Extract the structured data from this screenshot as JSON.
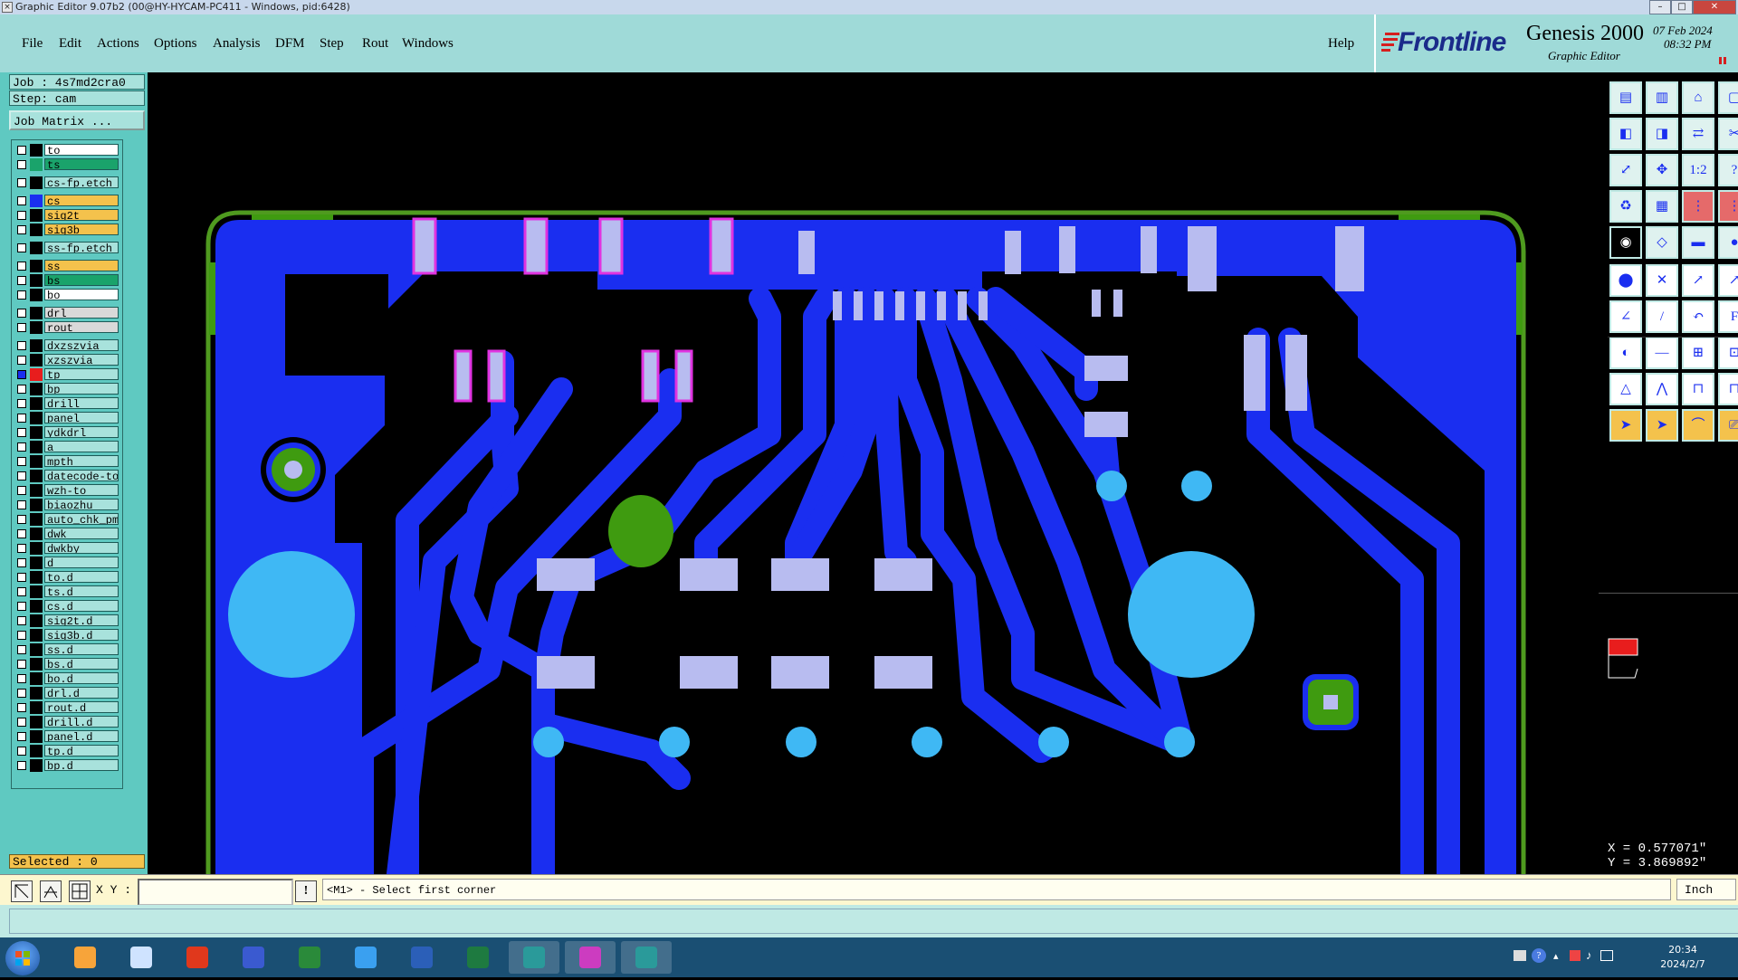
{
  "window": {
    "title": "Graphic Editor 9.07b2 (00@HY-HYCAM-PC411 - Windows, pid:6428)"
  },
  "menubar": {
    "items": [
      "File",
      "Edit",
      "Actions",
      "Options",
      "Analysis",
      "DFM",
      "Step",
      "Rout",
      "Windows"
    ],
    "help": "Help"
  },
  "brand": {
    "logo": "Frontline",
    "product": "Genesis 2000",
    "subtitle": "Graphic Editor",
    "date": "07 Feb 2024",
    "time": "08:32 PM"
  },
  "job": {
    "job_label": "Job : 4s7md2cra0",
    "step_label": "Step: cam",
    "matrix_button": "Job Matrix ..."
  },
  "layers": [
    {
      "name": "to",
      "color": "#ffffff",
      "swatch": "#000000",
      "group": 0
    },
    {
      "name": "ts",
      "color": "#1aa36b",
      "swatch": "#1aa36b",
      "group": 0
    },
    {
      "name": "cs-fp.etch",
      "color": "#a8e2dc",
      "swatch": "#000000",
      "group": 1
    },
    {
      "name": "cs",
      "color": "#f4c24c",
      "swatch": "#1a2ef0",
      "group": 2
    },
    {
      "name": "sig2t",
      "color": "#f4c24c",
      "swatch": "#000000",
      "group": 2
    },
    {
      "name": "sig3b",
      "color": "#f4c24c",
      "swatch": "#000000",
      "group": 2
    },
    {
      "name": "ss-fp.etch",
      "color": "#a8e2dc",
      "swatch": "#000000",
      "group": 3
    },
    {
      "name": "ss",
      "color": "#f4c24c",
      "swatch": "#000000",
      "group": 4
    },
    {
      "name": "bs",
      "color": "#1aa36b",
      "swatch": "#000000",
      "group": 4
    },
    {
      "name": "bo",
      "color": "#ffffff",
      "swatch": "#000000",
      "group": 4
    },
    {
      "name": "drl",
      "color": "#d9d9d9",
      "swatch": "#000000",
      "group": 5
    },
    {
      "name": "rout",
      "color": "#d9d9d9",
      "swatch": "#000000",
      "group": 5
    },
    {
      "name": "dxzszvia",
      "color": "#a8e2dc",
      "swatch": "#000000",
      "group": 6
    },
    {
      "name": "xzszvia",
      "color": "#a8e2dc",
      "swatch": "#000000",
      "group": 6
    },
    {
      "name": "tp",
      "color": "#a8e2dc",
      "swatch": "#e81d1d",
      "group": 6,
      "active": true
    },
    {
      "name": "bp",
      "color": "#a8e2dc",
      "swatch": "#000000",
      "group": 6
    },
    {
      "name": "drill",
      "color": "#a8e2dc",
      "swatch": "#000000",
      "group": 6
    },
    {
      "name": "panel",
      "color": "#a8e2dc",
      "swatch": "#000000",
      "group": 6
    },
    {
      "name": "ydkdrl",
      "color": "#a8e2dc",
      "swatch": "#000000",
      "group": 6
    },
    {
      "name": "a",
      "color": "#a8e2dc",
      "swatch": "#000000",
      "group": 6
    },
    {
      "name": "mpth",
      "color": "#a8e2dc",
      "swatch": "#000000",
      "group": 6
    },
    {
      "name": "datecode-to",
      "color": "#a8e2dc",
      "swatch": "#000000",
      "group": 6
    },
    {
      "name": "wzh-to",
      "color": "#a8e2dc",
      "swatch": "#000000",
      "group": 6
    },
    {
      "name": "biaozhu",
      "color": "#a8e2dc",
      "swatch": "#000000",
      "group": 6
    },
    {
      "name": "auto_chk_pm",
      "color": "#a8e2dc",
      "swatch": "#000000",
      "group": 6
    },
    {
      "name": "dwk",
      "color": "#a8e2dc",
      "swatch": "#000000",
      "group": 6
    },
    {
      "name": "dwkby",
      "color": "#a8e2dc",
      "swatch": "#000000",
      "group": 6
    },
    {
      "name": "d",
      "color": "#a8e2dc",
      "swatch": "#000000",
      "group": 6
    },
    {
      "name": "to.d",
      "color": "#a8e2dc",
      "swatch": "#000000",
      "group": 6
    },
    {
      "name": "ts.d",
      "color": "#a8e2dc",
      "swatch": "#000000",
      "group": 6
    },
    {
      "name": "cs.d",
      "color": "#a8e2dc",
      "swatch": "#000000",
      "group": 6
    },
    {
      "name": "sig2t.d",
      "color": "#a8e2dc",
      "swatch": "#000000",
      "group": 6
    },
    {
      "name": "sig3b.d",
      "color": "#a8e2dc",
      "swatch": "#000000",
      "group": 6
    },
    {
      "name": "ss.d",
      "color": "#a8e2dc",
      "swatch": "#000000",
      "group": 6
    },
    {
      "name": "bs.d",
      "color": "#a8e2dc",
      "swatch": "#000000",
      "group": 6
    },
    {
      "name": "bo.d",
      "color": "#a8e2dc",
      "swatch": "#000000",
      "group": 6
    },
    {
      "name": "drl.d",
      "color": "#a8e2dc",
      "swatch": "#000000",
      "group": 6
    },
    {
      "name": "rout.d",
      "color": "#a8e2dc",
      "swatch": "#000000",
      "group": 6
    },
    {
      "name": "drill.d",
      "color": "#a8e2dc",
      "swatch": "#000000",
      "group": 6
    },
    {
      "name": "panel.d",
      "color": "#a8e2dc",
      "swatch": "#000000",
      "group": 6
    },
    {
      "name": "tp.d",
      "color": "#a8e2dc",
      "swatch": "#000000",
      "group": 6
    },
    {
      "name": "bp.d",
      "color": "#a8e2dc",
      "swatch": "#000000",
      "group": 6
    }
  ],
  "selected": "Selected : 0",
  "command": {
    "xy_label": "X Y :",
    "xy_value": "",
    "prompt": "<M1> - Select first corner",
    "units": "Inch"
  },
  "coords": {
    "x": "X = 0.577071\"",
    "y": "Y = 3.869892\""
  },
  "taskbar": {
    "time": "20:34",
    "date": "2024/2/7"
  },
  "colors": {
    "copper": "#1a2ef0",
    "pad": "#b8bcf0",
    "pad_outline": "#e033e0",
    "hole": "#3fb8f4",
    "silk": "#3f9b10",
    "outline": "#4f9a1f",
    "panel": "#9fdad8",
    "layer_bg": "#5fc9c1"
  }
}
